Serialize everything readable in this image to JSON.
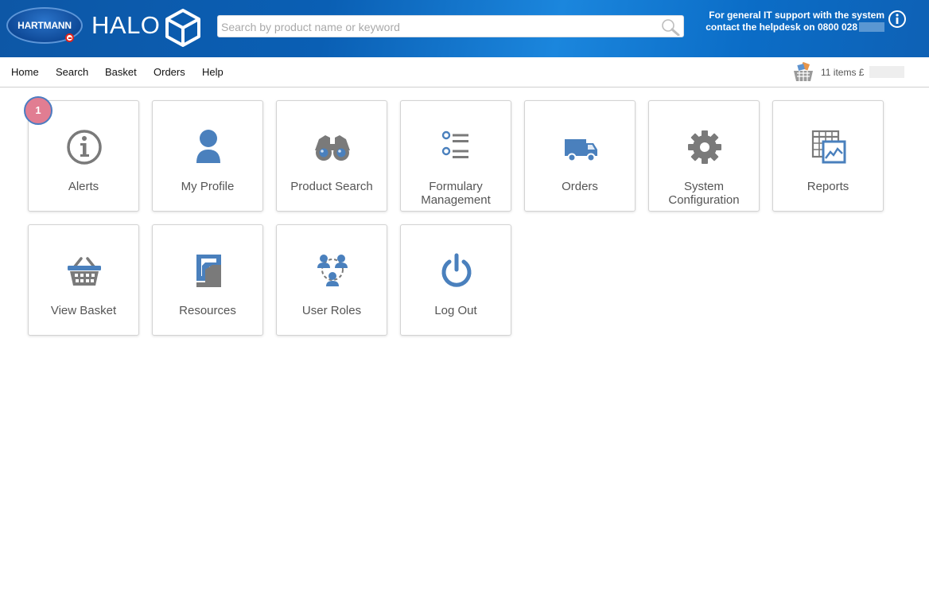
{
  "header": {
    "brand_logo_text": "HARTMANN",
    "app_title": "HALO",
    "search_placeholder": "Search by product name or keyword",
    "support_line1": "For general IT support with the system",
    "support_line2": "contact the helpdesk on 0800 028"
  },
  "nav": {
    "items": [
      "Home",
      "Search",
      "Basket",
      "Orders",
      "Help"
    ],
    "basket_count": "11 items £"
  },
  "alerts_badge": "1",
  "tiles": {
    "alerts": "Alerts",
    "my_profile": "My Profile",
    "product_search": "Product Search",
    "formulary_management_1": "Formulary",
    "formulary_management_2": "Management",
    "orders": "Orders",
    "system_configuration_1": "System",
    "system_configuration_2": "Configuration",
    "reports": "Reports",
    "view_basket": "View Basket",
    "resources": "Resources",
    "user_roles": "User Roles",
    "log_out": "Log Out"
  },
  "colors": {
    "accent_blue": "#4a80bd",
    "icon_grey": "#7a7a7a",
    "badge_pink": "#e17d92",
    "header_blue": "#0a5fb4"
  }
}
